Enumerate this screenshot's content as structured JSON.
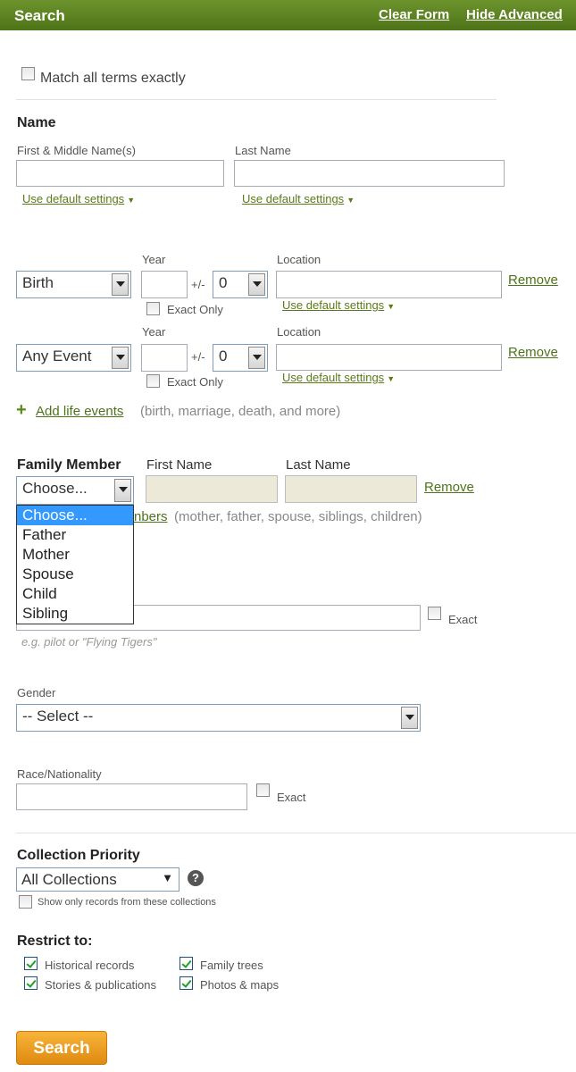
{
  "header": {
    "title": "Search",
    "clear_form": "Clear Form",
    "hide_advanced": "Hide Advanced"
  },
  "match_exact": {
    "label": "Match all terms exactly",
    "checked": false
  },
  "name": {
    "heading": "Name",
    "first_label": "First & Middle Name(s)",
    "last_label": "Last Name",
    "first_value": "",
    "last_value": "",
    "first_defaults": "Use default settings",
    "last_defaults": "Use default settings"
  },
  "events": [
    {
      "type": "Birth",
      "year_label": "Year",
      "year": "",
      "pm": "+/-",
      "range": "0",
      "exact": "Exact Only",
      "location_label": "Location",
      "location": "",
      "defaults": "Use default settings",
      "remove": "Remove"
    },
    {
      "type": "Any Event",
      "year_label": "Year",
      "year": "",
      "pm": "+/-",
      "range": "0",
      "exact": "Exact Only",
      "location_label": "Location",
      "location": "",
      "defaults": "Use default settings",
      "remove": "Remove"
    }
  ],
  "add_events": {
    "link": "Add life events",
    "hint": "(birth, marriage, death, and more)"
  },
  "family": {
    "member_label": "Family Member",
    "first_label": "First Name",
    "last_label": "Last Name",
    "selected": "Choose...",
    "remove": "Remove",
    "add_link_tail": "nbers",
    "hint": "(mother, father, spouse, siblings, children)",
    "options": [
      "Choose...",
      "Father",
      "Mother",
      "Spouse",
      "Child",
      "Sibling"
    ]
  },
  "keyword": {
    "value": "",
    "exact": "Exact",
    "example": "e.g. pilot or \"Flying Tigers\""
  },
  "gender": {
    "label": "Gender",
    "selected": "-- Select --"
  },
  "race": {
    "label": "Race/Nationality",
    "value": "",
    "exact": "Exact"
  },
  "collection": {
    "heading": "Collection Priority",
    "selected": "All Collections",
    "help": "?",
    "show_only": "Show only records from these collections"
  },
  "restrict": {
    "heading": "Restrict to:",
    "items": [
      {
        "label": "Historical records",
        "checked": true
      },
      {
        "label": "Family trees",
        "checked": true
      },
      {
        "label": "Stories & publications",
        "checked": true
      },
      {
        "label": "Photos & maps",
        "checked": true
      }
    ]
  },
  "search_button": "Search",
  "colors": {
    "header": "#5a7f22",
    "link": "#4e7419",
    "button": "#f0a020",
    "highlight": "#3399ff"
  }
}
